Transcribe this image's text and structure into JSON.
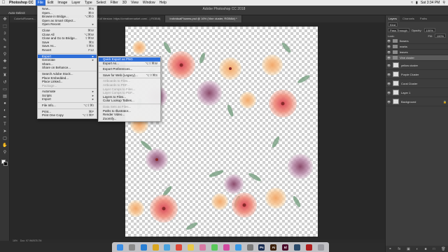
{
  "menubar": {
    "apple": "",
    "items": [
      "Photoshop CC",
      "File",
      "Edit",
      "Image",
      "Layer",
      "Type",
      "Select",
      "Filter",
      "3D",
      "View",
      "Window",
      "Help"
    ],
    "active_index": 1,
    "clock": "Sat 3:34 PM"
  },
  "optbar": {
    "app_title": "Adobe Photoshop CC 2018",
    "auto_select": "Auto-Select:"
  },
  "tabs": [
    {
      "label": "ColorfulFlowers...",
      "active": false
    },
    {
      "label": "Invitation Card & Envelope.psd @ 66.7% (Full Version: https://creativemarket.com/...) RGB/8)",
      "active": false
    },
    {
      "label": "IndividualFlowers.psd @ 16% (Vine cluster, RGB/8#) *",
      "active": true
    }
  ],
  "status": {
    "zoom": "16%",
    "doc": "Doc: 97.9M/578.7M"
  },
  "file_menu": {
    "items": [
      {
        "label": "New...",
        "sc": "⌘N",
        "type": "item"
      },
      {
        "label": "Open...",
        "sc": "⌘O",
        "type": "item"
      },
      {
        "label": "Browse in Bridge...",
        "sc": "⌥⌘O",
        "type": "item"
      },
      {
        "label": "Open as Smart Object...",
        "sc": "",
        "type": "item"
      },
      {
        "label": "Open Recent",
        "sc": "▸",
        "type": "item"
      },
      {
        "type": "sep"
      },
      {
        "label": "Close",
        "sc": "⌘W",
        "type": "item"
      },
      {
        "label": "Close All",
        "sc": "⌥⌘W",
        "type": "item"
      },
      {
        "label": "Close and Go to Bridge...",
        "sc": "⇧⌘W",
        "type": "item"
      },
      {
        "label": "Save",
        "sc": "⌘S",
        "type": "item"
      },
      {
        "label": "Save As...",
        "sc": "⇧⌘S",
        "type": "item"
      },
      {
        "label": "Revert",
        "sc": "F12",
        "type": "item"
      },
      {
        "type": "sep"
      },
      {
        "label": "Export",
        "sc": "▸",
        "type": "item",
        "highlight": true
      },
      {
        "label": "Generate",
        "sc": "▸",
        "type": "item"
      },
      {
        "label": "Share...",
        "sc": "",
        "type": "item"
      },
      {
        "label": "Share on Behance...",
        "sc": "",
        "type": "item"
      },
      {
        "type": "sep"
      },
      {
        "label": "Search Adobe Stock...",
        "sc": "",
        "type": "item"
      },
      {
        "label": "Place Embedded...",
        "sc": "",
        "type": "item"
      },
      {
        "label": "Place Linked...",
        "sc": "",
        "type": "item"
      },
      {
        "label": "Package...",
        "sc": "",
        "type": "item",
        "disabled": true
      },
      {
        "type": "sep"
      },
      {
        "label": "Automate",
        "sc": "▸",
        "type": "item"
      },
      {
        "label": "Scripts",
        "sc": "▸",
        "type": "item"
      },
      {
        "label": "Import",
        "sc": "▸",
        "type": "item"
      },
      {
        "type": "sep"
      },
      {
        "label": "File Info...",
        "sc": "⌥⇧⌘I",
        "type": "item"
      },
      {
        "type": "sep"
      },
      {
        "label": "Print...",
        "sc": "⌘P",
        "type": "item"
      },
      {
        "label": "Print One Copy",
        "sc": "⌥⇧⌘P",
        "type": "item"
      }
    ]
  },
  "export_menu": {
    "items": [
      {
        "label": "Quick Export as PNG",
        "sc": "",
        "type": "item",
        "highlight": true
      },
      {
        "label": "Export As...",
        "sc": "⌥⇧⌘W",
        "type": "item"
      },
      {
        "type": "sep"
      },
      {
        "label": "Export Preferences...",
        "sc": "",
        "type": "item"
      },
      {
        "type": "sep"
      },
      {
        "label": "Save for Web (Legacy)...",
        "sc": "⌥⇧⌘S",
        "type": "item"
      },
      {
        "type": "sep"
      },
      {
        "label": "Artboards to Files...",
        "sc": "",
        "type": "item",
        "disabled": true
      },
      {
        "label": "Artboards to PDF...",
        "sc": "",
        "type": "item",
        "disabled": true
      },
      {
        "label": "Layer Comps to Files...",
        "sc": "",
        "type": "item",
        "disabled": true
      },
      {
        "label": "Layer Comps to PDF...",
        "sc": "",
        "type": "item",
        "disabled": true
      },
      {
        "label": "Layers to Files...",
        "sc": "",
        "type": "item"
      },
      {
        "label": "Color Lookup Tables...",
        "sc": "",
        "type": "item"
      },
      {
        "type": "sep"
      },
      {
        "label": "Data Sets as Files...",
        "sc": "",
        "type": "item",
        "disabled": true
      },
      {
        "label": "Paths to Illustrator...",
        "sc": "",
        "type": "item"
      },
      {
        "label": "Render Video...",
        "sc": "",
        "type": "item"
      },
      {
        "label": "Zoomify...",
        "sc": "",
        "type": "item"
      }
    ]
  },
  "layers_panel": {
    "tabs": [
      "Layers",
      "Channels",
      "Paths"
    ],
    "filter_label": "Kind",
    "blend_mode": "Pass Through",
    "opacity_label": "Opacity:",
    "opacity": "100%",
    "lock_label": "Lock:",
    "fill_label": "Fill:",
    "fill": "100%",
    "layers": [
      {
        "name": "flowers",
        "kind": "folder",
        "selected": false
      },
      {
        "name": "marks",
        "kind": "folder",
        "selected": false
      },
      {
        "name": "leaves",
        "kind": "folder",
        "selected": false
      },
      {
        "name": "Vine cluster",
        "kind": "folder",
        "selected": true
      },
      {
        "name": "yellow cluster",
        "kind": "layer",
        "selected": false
      },
      {
        "name": "Purple Cluster",
        "kind": "layer",
        "selected": false
      },
      {
        "name": "Coral Cluster",
        "kind": "layer",
        "selected": false
      },
      {
        "name": "Layer 1",
        "kind": "layer",
        "selected": false
      },
      {
        "name": "Background",
        "kind": "layer",
        "selected": false,
        "locked": true
      }
    ]
  },
  "dock": {
    "apps": [
      {
        "icon": "finder-icon",
        "color": "#3a8ee6",
        "label": ""
      },
      {
        "icon": "launchpad-icon",
        "color": "#8a8a8a",
        "label": ""
      },
      {
        "icon": "safari-icon",
        "color": "#2a7fd4",
        "label": ""
      },
      {
        "icon": "chrome-icon",
        "color": "#d9a520",
        "label": ""
      },
      {
        "icon": "mail-icon",
        "color": "#4aa3e0",
        "label": ""
      },
      {
        "icon": "calendar-icon",
        "color": "#e04a3a",
        "label": ""
      },
      {
        "icon": "notes-icon",
        "color": "#e8c94a",
        "label": ""
      },
      {
        "icon": "photos-icon",
        "color": "#d87aa5",
        "label": ""
      },
      {
        "icon": "messages-icon",
        "color": "#5ac85a",
        "label": ""
      },
      {
        "icon": "itunes-icon",
        "color": "#d24aa0",
        "label": ""
      },
      {
        "icon": "appstore-icon",
        "color": "#3a9ae6",
        "label": ""
      },
      {
        "icon": "settings-icon",
        "color": "#7a7a7a",
        "label": ""
      },
      {
        "icon": "photoshop-icon",
        "color": "#1b2e52",
        "label": "Ps"
      },
      {
        "icon": "illustrator-icon",
        "color": "#3b1f0a",
        "label": "Ai"
      },
      {
        "icon": "indesign-icon",
        "color": "#4a0a2a",
        "label": "Id"
      },
      {
        "icon": "lightroom-icon",
        "color": "#2b4a6a",
        "label": ""
      },
      {
        "icon": "acrobat-icon",
        "color": "#b01e1e",
        "label": ""
      },
      {
        "icon": "trash-icon",
        "color": "#9a9aa0",
        "label": ""
      }
    ]
  }
}
